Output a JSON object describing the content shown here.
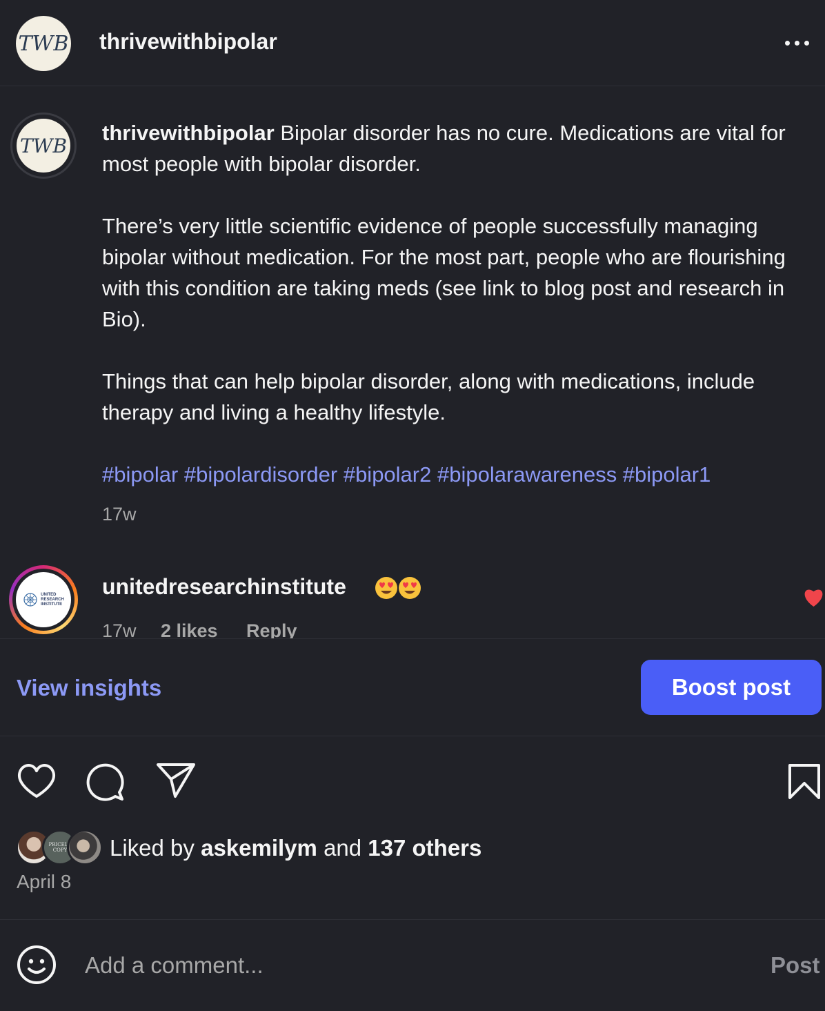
{
  "post": {
    "author": {
      "username": "thrivewithbipolar",
      "avatar_monogram": "TWB"
    },
    "caption": {
      "username": "thrivewithbipolar",
      "paragraph_1": "Bipolar disorder has no cure. Medications are vital for most people with bipolar disorder.",
      "paragraph_2": "There’s very little scientific evidence of people successfully managing bipolar without medication. For the most part, people who are flourishing with this condition are taking meds (see link to blog post and research in Bio).",
      "paragraph_3": "Things that can help bipolar disorder, along with medications, include therapy and living a healthy lifestyle.",
      "hashtags": "#bipolar #bipolardisorder #bipolar2 #bipolarawareness #bipolar1",
      "time": "17w"
    },
    "comments": [
      {
        "username": "unitedresearchinstitute",
        "avatar_logo_text": [
          "UNITED",
          "RESEARCH",
          "INSTITUTE"
        ],
        "emoji": "😍😍",
        "time": "17w",
        "likes": "2 likes",
        "reply_label": "Reply",
        "liked": true
      }
    ],
    "insights": {
      "view_label": "View insights",
      "boost_label": "Boost post"
    },
    "likes": {
      "prefix": "Liked by",
      "user": "askemilym",
      "conjunction": "and",
      "others": "137 others",
      "avatar_2_text": [
        "PRICELE",
        "COPY"
      ]
    },
    "date": "April 8",
    "comment_box": {
      "placeholder": "Add a comment...",
      "post_label": "Post"
    }
  },
  "colors": {
    "background": "#212228",
    "text": "#f5f5f5",
    "muted": "#a8a8a8",
    "link": "#8c99f5",
    "boost": "#4a5ef7",
    "like_red": "#f0454b"
  },
  "icons": [
    "more-icon",
    "heart-icon",
    "comment-icon",
    "share-icon",
    "bookmark-icon",
    "emoji-icon",
    "love-eyes-emoji-icon"
  ]
}
